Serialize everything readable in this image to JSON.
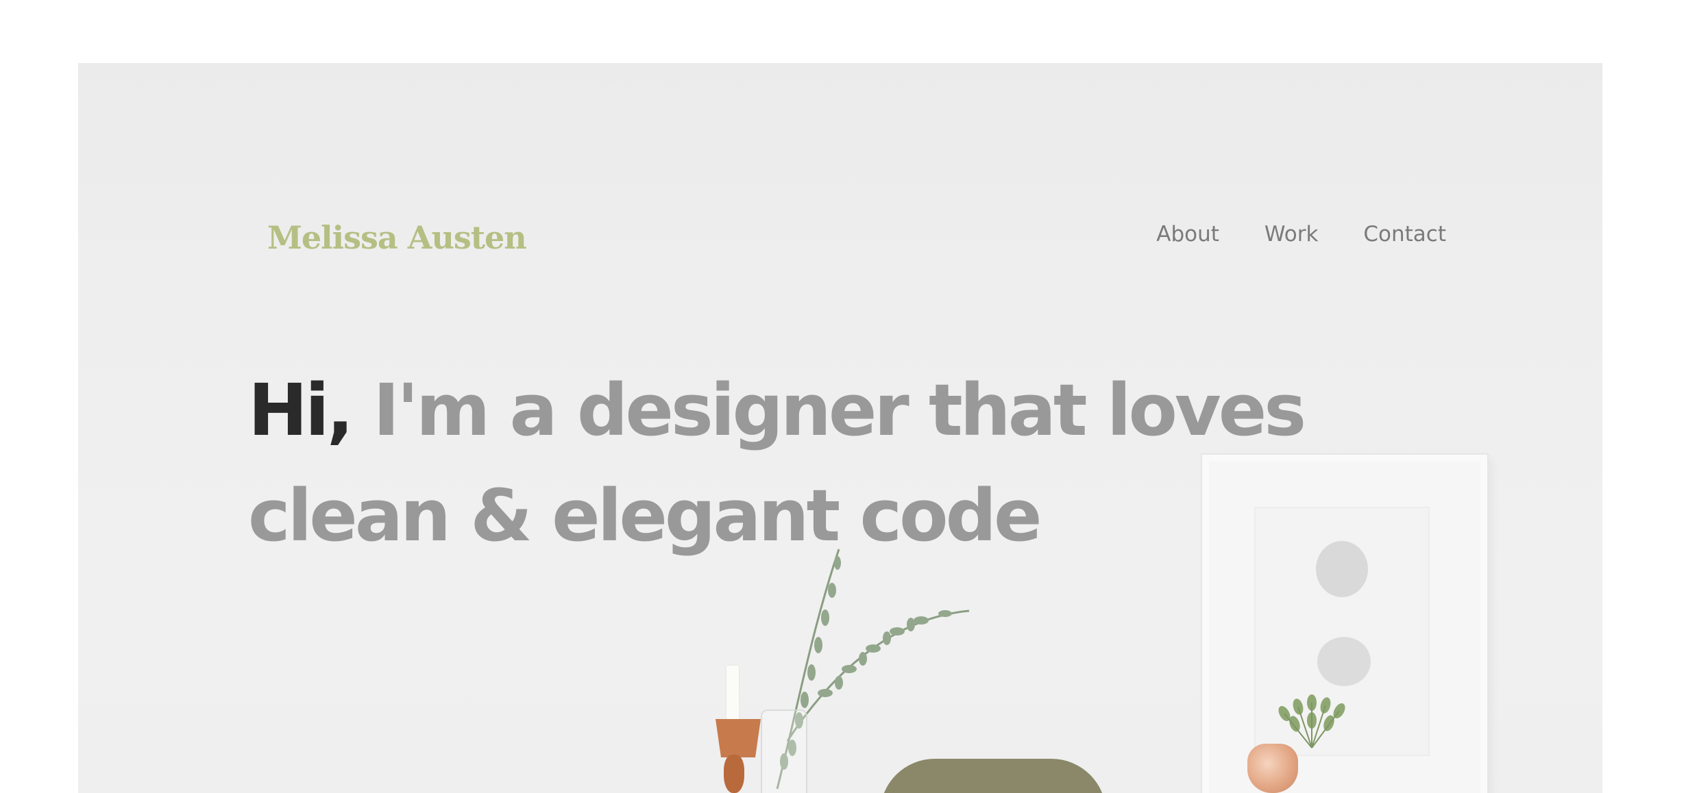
{
  "header": {
    "brand": "Melissa Austen",
    "nav": [
      {
        "label": "About"
      },
      {
        "label": "Work"
      },
      {
        "label": "Contact"
      }
    ]
  },
  "hero": {
    "greeting": "Hi,",
    "headline": "I'm a designer that loves clean & elegant code"
  },
  "colors": {
    "brand": "#b5bf83",
    "nav_text": "#7a7a7a",
    "greeting": "#2a2a2a",
    "headline": "#999999",
    "hero_background": "#eeeeee"
  }
}
